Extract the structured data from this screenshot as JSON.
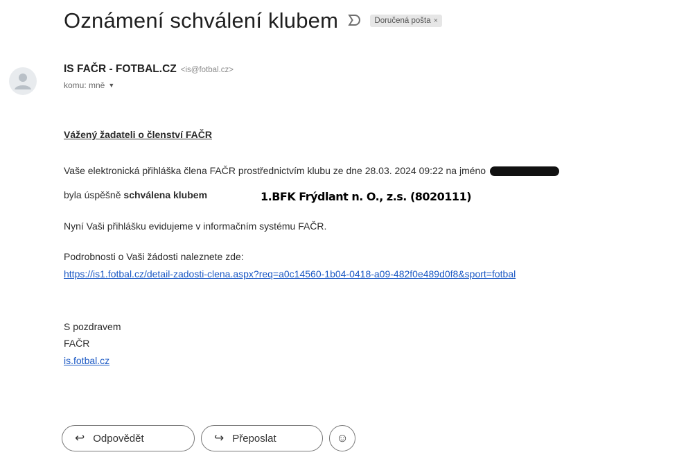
{
  "subject": {
    "title": "Oznámení schválení klubem",
    "label": "Doručená pošta",
    "label_close": "×"
  },
  "sender": {
    "name": "IS FAČR - FOTBAL.CZ",
    "email": "<is@fotbal.cz>",
    "to": "komu: mně"
  },
  "body": {
    "greeting": "Vážený žadateli o členství FAČR",
    "para1": "Vaše elektronická přihláška člena FAČR prostřednictvím klubu ze dne 28.03. 2024 09:22 na jméno",
    "para1b_prefix": "byla úspěšně ",
    "para1b_bold": "schválena klubem",
    "club_name": "1.BFK Frýdlant n. O., z.s. (8020111)",
    "para2": "Nyní Vaši přihlášku evidujeme v informačním systému FAČR.",
    "para3": "Podrobnosti o Vaši žádosti naleznete zde:",
    "link": "https://is1.fotbal.cz/detail-zadosti-clena.aspx?req=a0c14560-1b04-0418-a09-482f0e489d0f8&sport=fotbal",
    "sig_line1": "S pozdravem",
    "sig_line2": "FAČR",
    "sig_link": "is.fotbal.cz"
  },
  "actions": {
    "reply": "Odpovědět",
    "forward": "Přeposlat"
  },
  "icons": {
    "importance": "importance-marker-icon",
    "avatar": "default-avatar-icon",
    "reply": "reply-arrow-icon",
    "forward": "forward-arrow-icon",
    "emoji": "smiley-icon"
  },
  "colors": {
    "link": "#1a58c4",
    "chip_bg": "#e6e6e6"
  }
}
